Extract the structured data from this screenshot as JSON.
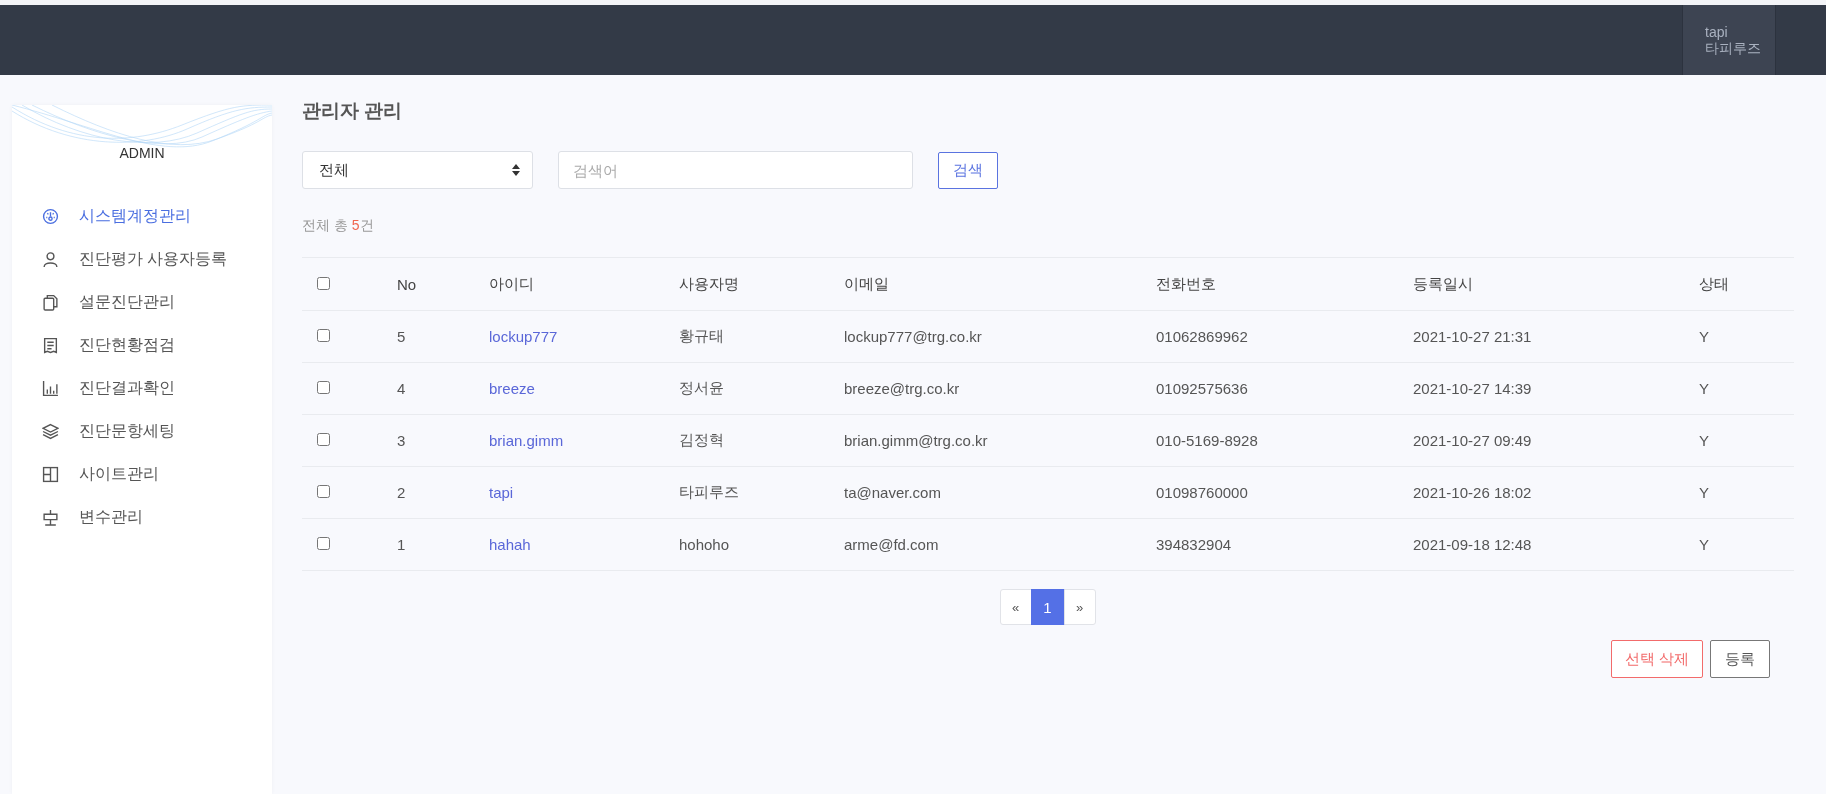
{
  "header": {
    "user_id": "tapi",
    "user_name": "타피루즈"
  },
  "sidebar": {
    "title": "ADMIN",
    "items": [
      {
        "label": "시스템계정관리",
        "selected": true
      },
      {
        "label": "진단평가 사용자등록",
        "selected": false
      },
      {
        "label": "설문진단관리",
        "selected": false
      },
      {
        "label": "진단현황점검",
        "selected": false
      },
      {
        "label": "진단결과확인",
        "selected": false
      },
      {
        "label": "진단문항세팅",
        "selected": false
      },
      {
        "label": "사이트관리",
        "selected": false
      },
      {
        "label": "변수관리",
        "selected": false
      }
    ]
  },
  "page_title": "관리자 관리",
  "filter": {
    "select_value": "전체",
    "search_placeholder": "검색어",
    "search_button": "검색"
  },
  "total": {
    "prefix": "전체 총 ",
    "count": "5",
    "suffix": "건"
  },
  "table": {
    "all_checked": false,
    "columns": [
      "No",
      "아이디",
      "사용자명",
      "이메일",
      "전화번호",
      "등록일시",
      "상태"
    ],
    "rows": [
      {
        "checked": false,
        "cells": [
          "5",
          "lockup777",
          "황규태",
          "lockup777@trg.co.kr",
          "01062869962",
          "2021-10-27 21:31",
          "Y"
        ]
      },
      {
        "checked": false,
        "cells": [
          "4",
          "breeze",
          "정서윤",
          "breeze@trg.co.kr",
          "01092575636",
          "2021-10-27 14:39",
          "Y"
        ]
      },
      {
        "checked": false,
        "cells": [
          "3",
          "brian.gimm",
          "김정혁",
          "brian.gimm@trg.co.kr",
          "010-5169-8928",
          "2021-10-27 09:49",
          "Y"
        ]
      },
      {
        "checked": false,
        "cells": [
          "2",
          "tapi",
          "타피루즈",
          "ta@naver.com",
          "01098760000",
          "2021-10-26 18:02",
          "Y"
        ]
      },
      {
        "checked": false,
        "cells": [
          "1",
          "hahah",
          "hohoho",
          "arme@fd.com",
          "394832904",
          "2021-09-18 12:48",
          "Y"
        ]
      }
    ]
  },
  "pagination": {
    "prev": "«",
    "pages": [
      {
        "label": "1",
        "selected": true
      }
    ],
    "next": "»"
  },
  "actions": {
    "delete": "선택 삭제",
    "register": "등록"
  }
}
